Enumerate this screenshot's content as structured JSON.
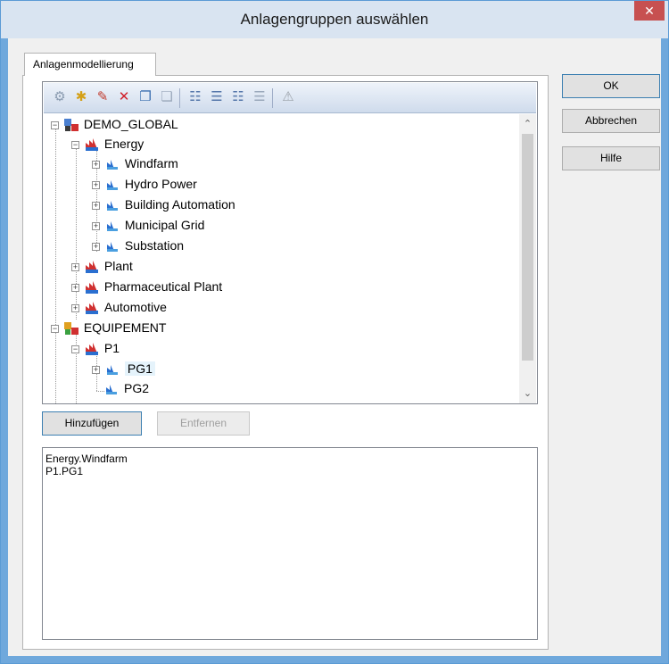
{
  "window": {
    "title": "Anlagengruppen auswählen",
    "close_glyph": "✕"
  },
  "tab": {
    "label": "Anlagenmodellierung"
  },
  "buttons": {
    "ok": "OK",
    "cancel": "Abbrechen",
    "help": "Hilfe",
    "add": "Hinzufügen",
    "remove": "Entfernen"
  },
  "toolbar": {
    "icons": [
      "plant-group-icon",
      "new-plant-icon",
      "edit-icon",
      "delete-icon",
      "copy-icon",
      "paste-icon",
      "expand-all-icon",
      "collapse-all-icon",
      "expand-level-icon",
      "list-icon",
      "warning-icon"
    ]
  },
  "tree": {
    "nodes": [
      {
        "label": "DEMO_GLOBAL",
        "type": "root",
        "expanded": true
      },
      {
        "label": "Energy",
        "type": "plant",
        "expanded": true
      },
      {
        "label": "Windfarm",
        "type": "group",
        "expanded": false
      },
      {
        "label": "Hydro Power",
        "type": "group",
        "expanded": false
      },
      {
        "label": "Building Automation",
        "type": "group",
        "expanded": false
      },
      {
        "label": "Municipal Grid",
        "type": "group",
        "expanded": false
      },
      {
        "label": "Substation",
        "type": "group",
        "expanded": false
      },
      {
        "label": "Plant",
        "type": "plant",
        "expanded": false
      },
      {
        "label": "Pharmaceutical Plant",
        "type": "plant",
        "expanded": false
      },
      {
        "label": "Automotive",
        "type": "plant",
        "expanded": false
      },
      {
        "label": "EQUIPEMENT",
        "type": "root",
        "expanded": true
      },
      {
        "label": "P1",
        "type": "plant",
        "expanded": true
      },
      {
        "label": "PG1",
        "type": "group",
        "expanded": false,
        "selected": true
      },
      {
        "label": "PG2",
        "type": "group",
        "leaf": true
      }
    ]
  },
  "selected_list": {
    "items": [
      "Energy.Windfarm",
      "P1.PG1"
    ]
  },
  "colors": {
    "accent": "#3c7fb1",
    "close": "#c75050",
    "title_bg": "#d9e4f1"
  }
}
